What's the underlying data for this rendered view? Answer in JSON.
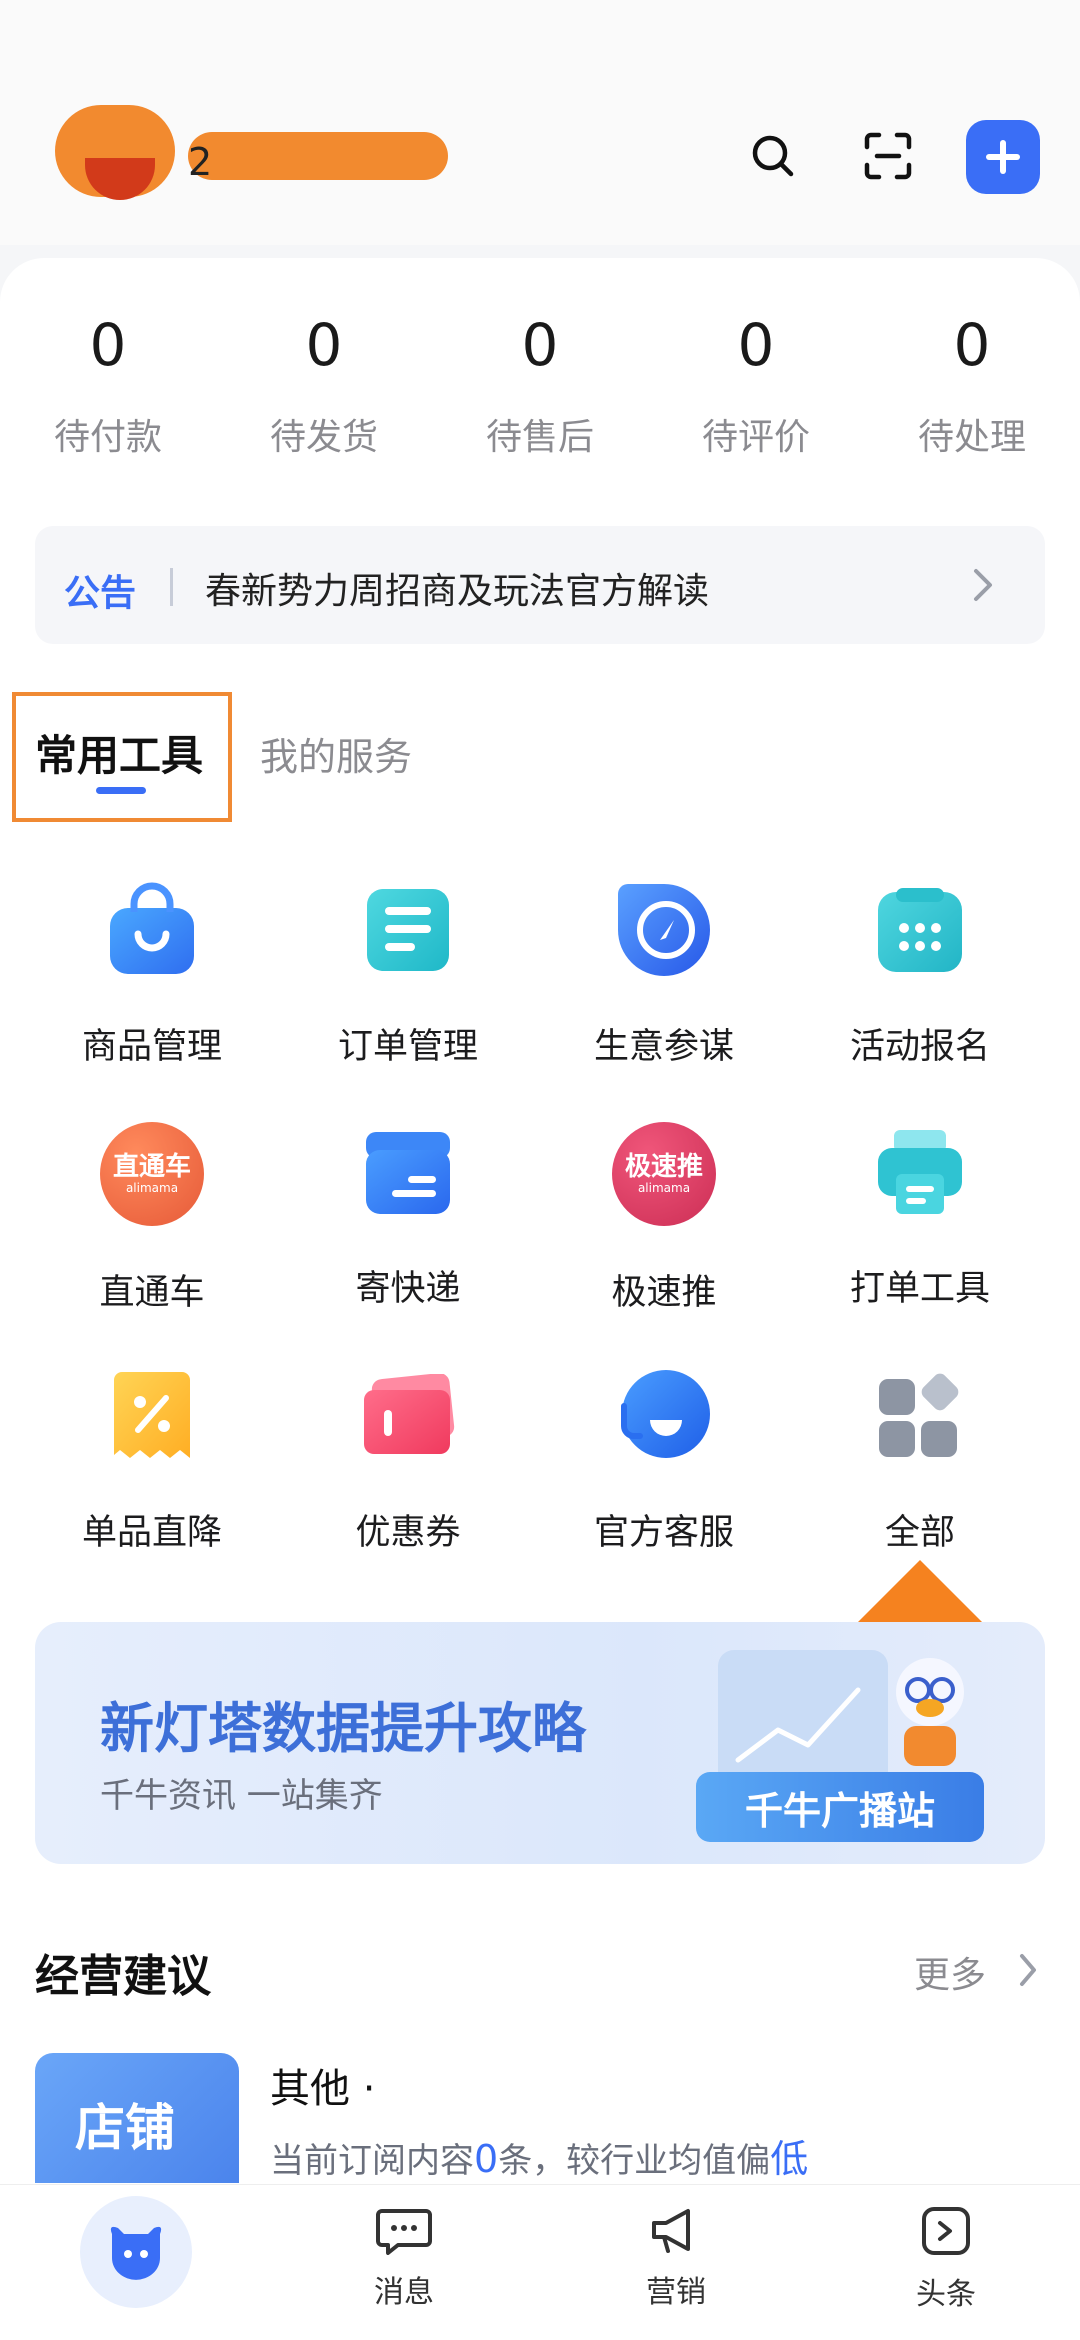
{
  "header": {
    "shop_name": "2",
    "icons": [
      "search-icon",
      "scan-icon",
      "plus-icon"
    ]
  },
  "stats": [
    {
      "value": "0",
      "label": "待付款"
    },
    {
      "value": "0",
      "label": "待发货"
    },
    {
      "value": "0",
      "label": "待售后"
    },
    {
      "value": "0",
      "label": "待评价"
    },
    {
      "value": "0",
      "label": "待处理"
    }
  ],
  "notice": {
    "tag": "公告",
    "text": "春新势力周招商及玩法官方解读"
  },
  "tabs": {
    "active": "常用工具",
    "inactive": "我的服务"
  },
  "tools": [
    {
      "label": "商品管理",
      "icon": "shopping-bag-icon"
    },
    {
      "label": "订单管理",
      "icon": "order-list-icon"
    },
    {
      "label": "生意参谋",
      "icon": "compass-icon"
    },
    {
      "label": "活动报名",
      "icon": "calendar-icon"
    },
    {
      "label": "直通车",
      "icon": "ztc-icon",
      "badge": "直通车",
      "badge_sub": "alimama"
    },
    {
      "label": "寄快递",
      "icon": "box-icon"
    },
    {
      "label": "极速推",
      "icon": "jst-icon",
      "badge": "极速推",
      "badge_sub": "alimama"
    },
    {
      "label": "打单工具",
      "icon": "printer-icon"
    },
    {
      "label": "单品直降",
      "icon": "discount-icon"
    },
    {
      "label": "优惠券",
      "icon": "coupon-icon"
    },
    {
      "label": "官方客服",
      "icon": "headset-icon"
    },
    {
      "label": "全部",
      "icon": "apps-icon"
    }
  ],
  "banner": {
    "title": "新灯塔数据提升攻略",
    "subtitle": "千牛资讯 一站集齐",
    "pill": "千牛广播站"
  },
  "section": {
    "title": "经营建议",
    "more": "更多"
  },
  "suggestion": {
    "thumb_text": "店铺",
    "title": "其他 ·",
    "desc_prefix": "当前订阅内容",
    "desc_count": "0",
    "desc_mid": "条，较行业均值偏",
    "desc_level": "低"
  },
  "bottom_nav": [
    {
      "label": "",
      "icon": "home-cow-icon"
    },
    {
      "label": "消息",
      "icon": "message-icon"
    },
    {
      "label": "营销",
      "icon": "megaphone-icon"
    },
    {
      "label": "头条",
      "icon": "news-icon"
    }
  ],
  "colors": {
    "accent": "#3a6ef6",
    "highlight_box": "#f08a34"
  }
}
